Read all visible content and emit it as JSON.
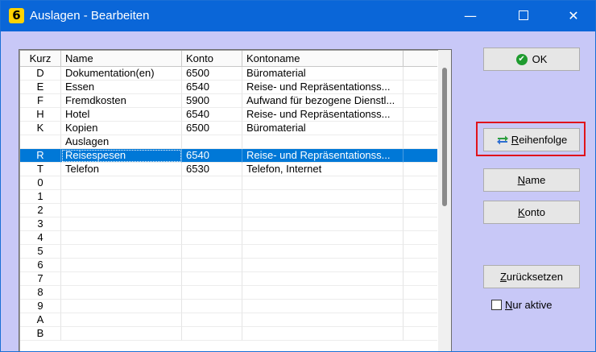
{
  "window": {
    "title": "Auslagen - Bearbeiten",
    "app_icon_text": "6",
    "min_glyph": "—",
    "close_glyph": "✕"
  },
  "grid": {
    "columns": [
      "Kurz",
      "Name",
      "Konto",
      "Kontoname",
      ""
    ],
    "selected_index": 6,
    "rows": [
      {
        "kurz": "D",
        "name": "Dokumentation(en)",
        "konto": "6500",
        "kontoname": "Büromaterial"
      },
      {
        "kurz": "E",
        "name": "Essen",
        "konto": "6540",
        "kontoname": "Reise- und Repräsentationss..."
      },
      {
        "kurz": "F",
        "name": "Fremdkosten",
        "konto": "5900",
        "kontoname": "Aufwand für bezogene Dienstl..."
      },
      {
        "kurz": "H",
        "name": "Hotel",
        "konto": "6540",
        "kontoname": "Reise- und Repräsentationss..."
      },
      {
        "kurz": "K",
        "name": "Kopien",
        "konto": "6500",
        "kontoname": "Büromaterial"
      },
      {
        "kurz": "",
        "name": "Auslagen",
        "konto": "",
        "kontoname": ""
      },
      {
        "kurz": "R",
        "name": "Reisespesen",
        "konto": "6540",
        "kontoname": "Reise- und Repräsentationss..."
      },
      {
        "kurz": "T",
        "name": "Telefon",
        "konto": "6530",
        "kontoname": "Telefon, Internet"
      },
      {
        "kurz": "0",
        "name": "",
        "konto": "",
        "kontoname": ""
      },
      {
        "kurz": "1",
        "name": "",
        "konto": "",
        "kontoname": ""
      },
      {
        "kurz": "2",
        "name": "",
        "konto": "",
        "kontoname": ""
      },
      {
        "kurz": "3",
        "name": "",
        "konto": "",
        "kontoname": ""
      },
      {
        "kurz": "4",
        "name": "",
        "konto": "",
        "kontoname": ""
      },
      {
        "kurz": "5",
        "name": "",
        "konto": "",
        "kontoname": ""
      },
      {
        "kurz": "6",
        "name": "",
        "konto": "",
        "kontoname": ""
      },
      {
        "kurz": "7",
        "name": "",
        "konto": "",
        "kontoname": ""
      },
      {
        "kurz": "8",
        "name": "",
        "konto": "",
        "kontoname": ""
      },
      {
        "kurz": "9",
        "name": "",
        "konto": "",
        "kontoname": ""
      },
      {
        "kurz": "A",
        "name": "",
        "konto": "",
        "kontoname": ""
      },
      {
        "kurz": "B",
        "name": "",
        "konto": "",
        "kontoname": ""
      }
    ]
  },
  "buttons": {
    "ok": "OK",
    "reihenfolge_first": "R",
    "reihenfolge_rest": "eihenfolge",
    "name_first": "N",
    "name_rest": "ame",
    "konto_first": "K",
    "konto_rest": "onto",
    "zuruecksetzen_first": "Z",
    "zuruecksetzen_rest": "urücksetzen"
  },
  "checkbox": {
    "label_first": "N",
    "label_rest": "ur aktive",
    "checked": false
  },
  "colors": {
    "titlebar": "#0a66d8",
    "dialog_bg": "#c8c8f7",
    "selection": "#0078d7",
    "highlight_border": "#e0131b"
  },
  "icons": {
    "ok": "green-check-icon",
    "reihenfolge": "swap-arrows-icon"
  }
}
